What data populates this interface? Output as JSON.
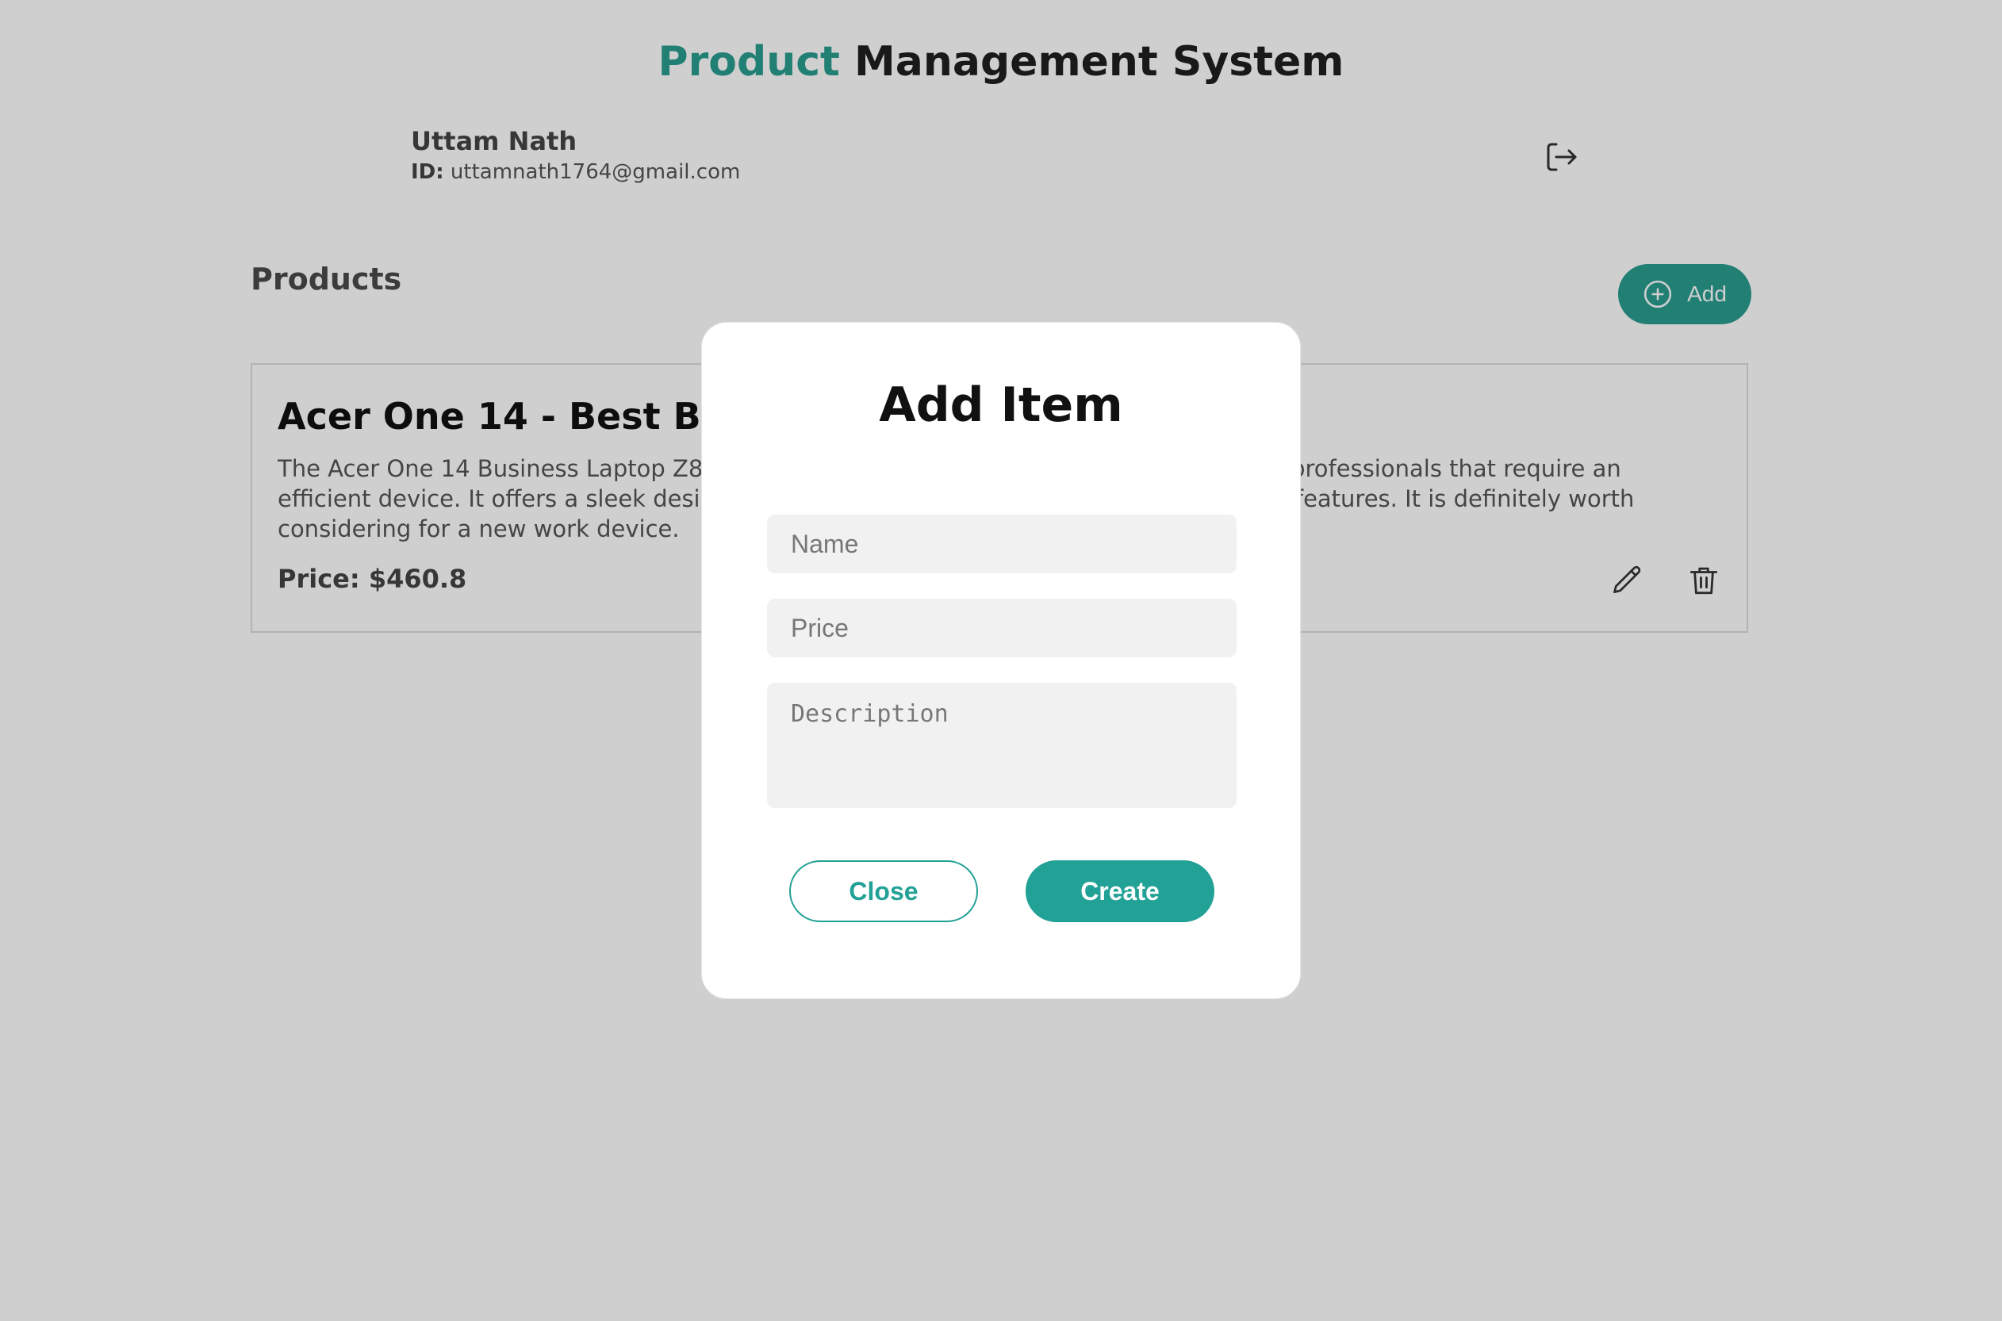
{
  "header": {
    "title_accent": "Product",
    "title_rest": "Management System"
  },
  "user": {
    "name": "Uttam Nath",
    "id_label": "ID:",
    "email": "uttamnath1764@gmail.com",
    "logout_icon": "logout-icon"
  },
  "products": {
    "section_title": "Products",
    "add_button_label": "Add",
    "add_icon": "plus-circle-icon",
    "items": [
      {
        "title": "Acer One 14 - Best Business Laptop",
        "description": "The Acer One 14 Business Laptop Z8-415 is a versatile and reliable laptop designed for professionals that require an efficient device. It offers a sleek design, solid performance, and many business-focused features. It is definitely worth considering for a new work device.",
        "price_label": "Price:",
        "price": "$460.8",
        "edit_icon": "pencil-icon",
        "delete_icon": "trash-icon"
      }
    ]
  },
  "modal": {
    "title": "Add Item",
    "name_placeholder": "Name",
    "price_placeholder": "Price",
    "description_placeholder": "Description",
    "close_label": "Close",
    "create_label": "Create"
  },
  "colors": {
    "accent": "#2a9d8f",
    "button": "#22a196",
    "overlay": "rgba(0,0,0,0.19)"
  }
}
